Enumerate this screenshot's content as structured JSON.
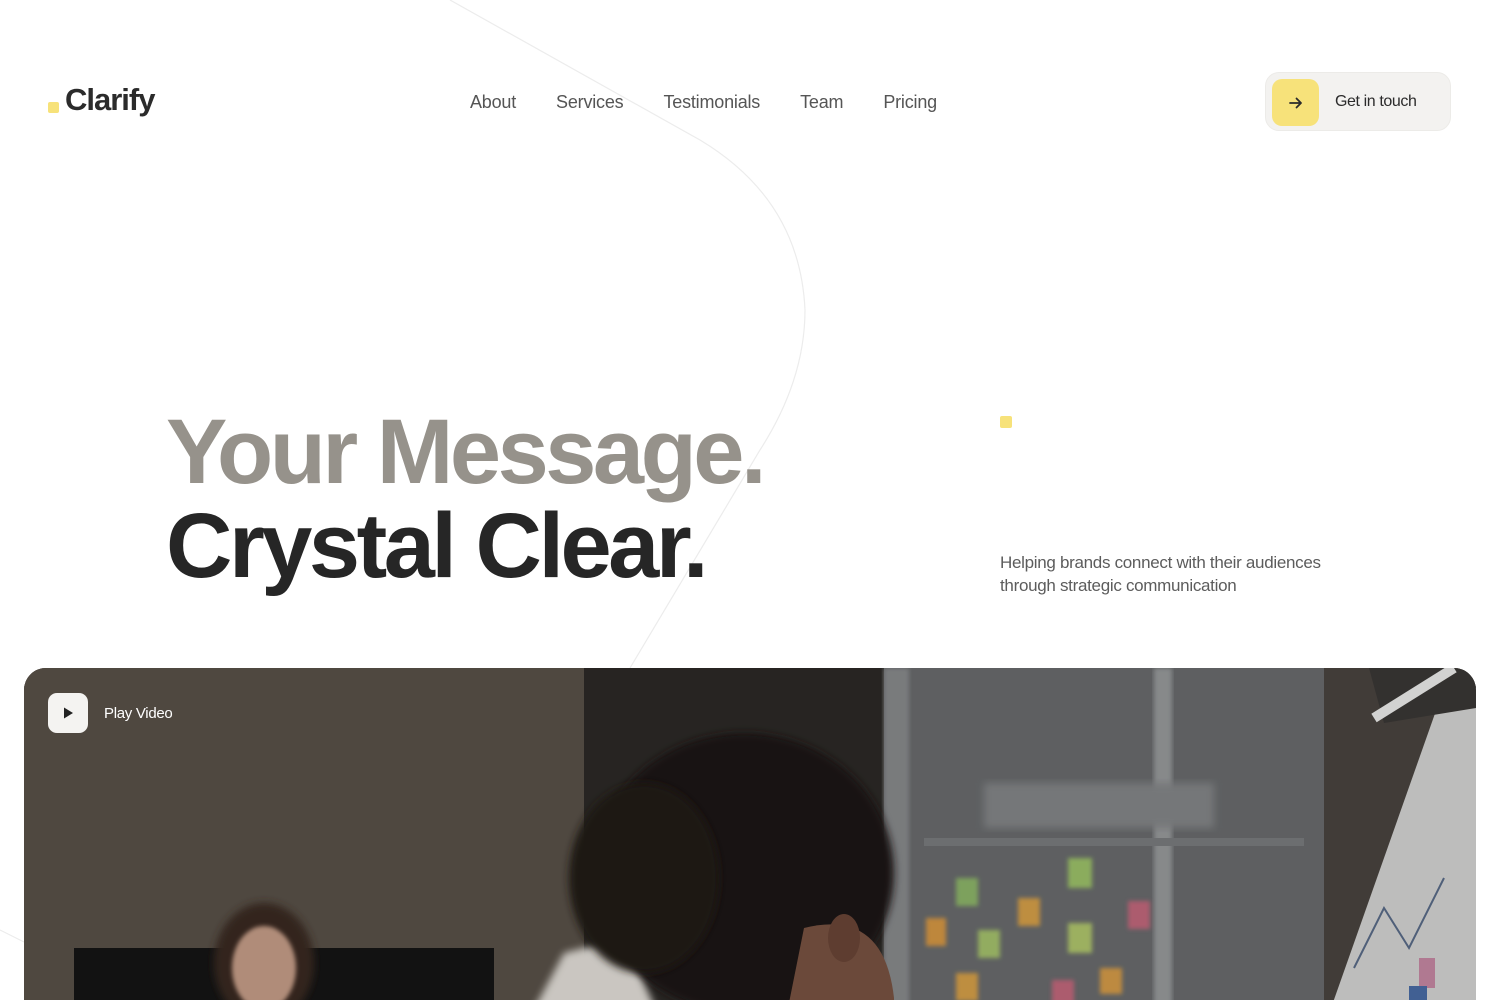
{
  "brand": {
    "name": "Clarify",
    "accent_color": "#f7e27a"
  },
  "nav": {
    "items": [
      {
        "label": "About"
      },
      {
        "label": "Services"
      },
      {
        "label": "Testimonials"
      },
      {
        "label": "Team"
      },
      {
        "label": "Pricing"
      }
    ]
  },
  "cta": {
    "label": "Get in touch",
    "icon": "arrow-right-icon"
  },
  "hero": {
    "headline_line_1": "Your Message.",
    "headline_line_2": "Crystal Clear.",
    "tagline": "Helping brands connect with their audiences through strategic communication"
  },
  "video": {
    "play_label": "Play Video",
    "play_icon": "play-icon"
  }
}
